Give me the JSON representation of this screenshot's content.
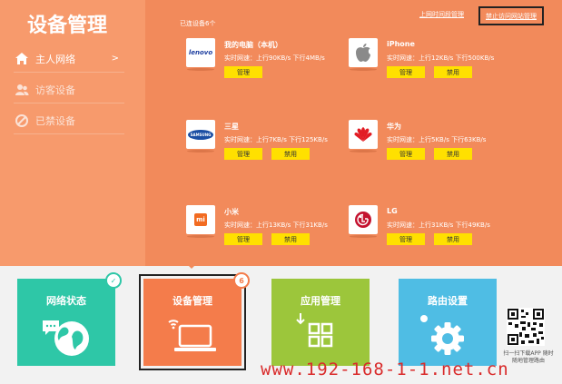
{
  "header": {
    "title": "设备管理"
  },
  "sidebar": {
    "items": [
      {
        "label": "主人网络",
        "active": true,
        "icon": "home-icon",
        "chevron": ">"
      },
      {
        "label": "访客设备",
        "active": false,
        "icon": "users-icon"
      },
      {
        "label": "已禁设备",
        "active": false,
        "icon": "blocked-icon"
      }
    ]
  },
  "main": {
    "connected_count": "已连设备6个",
    "links": {
      "online_manage": "上网时间段管理",
      "block_sites": "禁止访问网站管理"
    },
    "devices": [
      {
        "name": "我的电脑（本机）",
        "speed": "实时网速：上行90KB/s   下行4MB/s",
        "logo": "lenovo",
        "manage": "管理",
        "ban": ""
      },
      {
        "name": "iPhone",
        "speed": "实时网速：上行12KB/s   下行500KB/s",
        "logo": "apple",
        "manage": "管理",
        "ban": "禁用"
      },
      {
        "name": "三星",
        "speed": "实时网速：上行7KB/s   下行125KB/s",
        "logo": "samsung",
        "manage": "管理",
        "ban": "禁用"
      },
      {
        "name": "华为",
        "speed": "实时网速：上行5KB/s   下行63KB/s",
        "logo": "huawei",
        "manage": "管理",
        "ban": "禁用"
      },
      {
        "name": "小米",
        "speed": "实时网速：上行13KB/s   下行31KB/s",
        "logo": "xiaomi",
        "manage": "管理",
        "ban": "禁用"
      },
      {
        "name": "LG",
        "speed": "实时网速：上行31KB/s   下行49KB/s",
        "logo": "lg",
        "manage": "管理",
        "ban": "禁用"
      }
    ],
    "logos": {
      "lenovo": "lenovo",
      "samsung": "SAMSUNG",
      "xiaomi": "mi"
    }
  },
  "tiles": [
    {
      "label": "网络状态",
      "color": "#2ec7a7",
      "icon": "globe-icon"
    },
    {
      "label": "设备管理",
      "color": "#f47c4b",
      "icon": "laptop-wifi-icon",
      "badge": "6"
    },
    {
      "label": "应用管理",
      "color": "#9cc63b",
      "icon": "apps-grid-icon"
    },
    {
      "label": "路由设置",
      "color": "#4fbde4",
      "icon": "gear-icon"
    }
  ],
  "qr": {
    "caption": "扫一扫下载APP 随时随地管理路由"
  },
  "watermark": "www.192-168-1-1.net.cn",
  "colors": {
    "top_bg": "#f28a5b",
    "sidebar_bg": "#f79a6c",
    "button_yellow": "#ffe000"
  }
}
